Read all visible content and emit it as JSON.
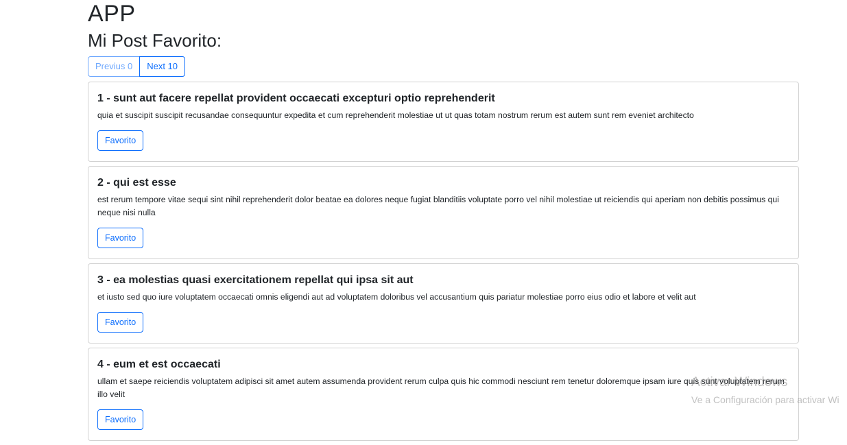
{
  "app": {
    "title": "APP",
    "subtitle": "Mi Post Favorito:"
  },
  "pager": {
    "prev_label": "Previus 0",
    "next_label": "Next 10"
  },
  "posts": [
    {
      "title": "1 - sunt aut facere repellat provident occaecati excepturi optio reprehenderit",
      "body": "quia et suscipit suscipit recusandae consequuntur expedita et cum reprehenderit molestiae ut ut quas totam nostrum rerum est autem sunt rem eveniet architecto",
      "button": "Favorito"
    },
    {
      "title": "2 - qui est esse",
      "body": "est rerum tempore vitae sequi sint nihil reprehenderit dolor beatae ea dolores neque fugiat blanditiis voluptate porro vel nihil molestiae ut reiciendis qui aperiam non debitis possimus qui neque nisi nulla",
      "button": "Favorito"
    },
    {
      "title": "3 - ea molestias quasi exercitationem repellat qui ipsa sit aut",
      "body": "et iusto sed quo iure voluptatem occaecati omnis eligendi aut ad voluptatem doloribus vel accusantium quis pariatur molestiae porro eius odio et labore et velit aut",
      "button": "Favorito"
    },
    {
      "title": "4 - eum et est occaecati",
      "body": "ullam et saepe reiciendis voluptatem adipisci sit amet autem assumenda provident rerum culpa quis hic commodi nesciunt rem tenetur doloremque ipsam iure quis sunt voluptatem rerum illo velit",
      "button": "Favorito"
    }
  ],
  "watermark": {
    "title": "Activar Windows",
    "subtitle": "Ve a Configuración para activar Wi"
  }
}
